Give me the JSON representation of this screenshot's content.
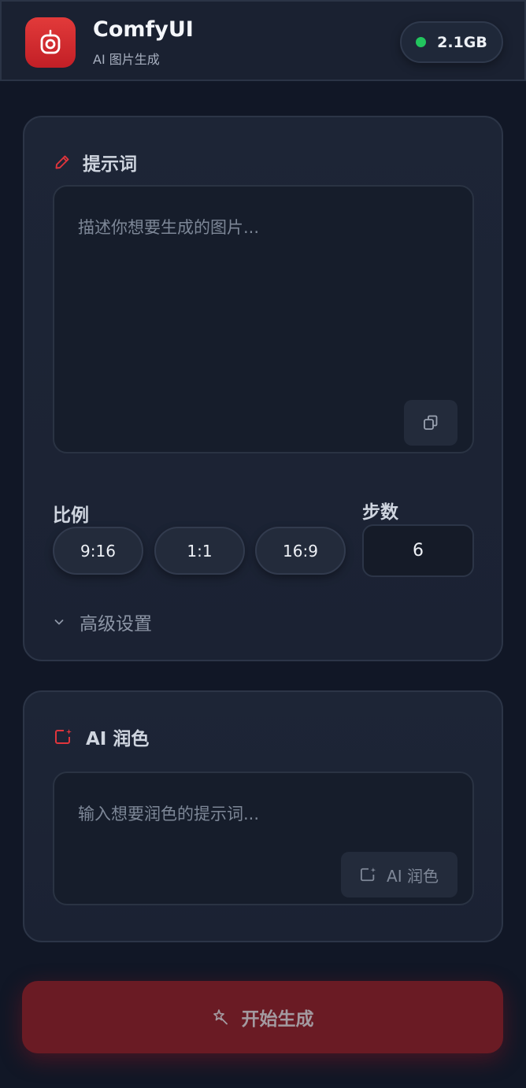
{
  "header": {
    "app_title": "ComfyUI",
    "app_subtitle": "AI 图片生成",
    "memory": "2.1GB",
    "status_color": "#22c55e",
    "logo_icon": "camera-icon"
  },
  "prompt_card": {
    "title": "提示词",
    "title_icon": "pencil-icon",
    "placeholder": "描述你想要生成的图片...",
    "copy_icon": "copy-icon",
    "ratio_label": "比例",
    "ratios": [
      "9:16",
      "1:1",
      "16:9"
    ],
    "steps_label": "步数",
    "steps_value": "6",
    "advanced_label": "高级设置"
  },
  "polish_card": {
    "title": "AI 润色",
    "title_icon": "sparkle-image-icon",
    "placeholder": "输入想要润色的提示词...",
    "button_label": "AI 润色"
  },
  "generate": {
    "label": "开始生成",
    "icon": "wand-icon"
  },
  "colors": {
    "accent_red": "#e23a3a",
    "background": "#111726"
  }
}
